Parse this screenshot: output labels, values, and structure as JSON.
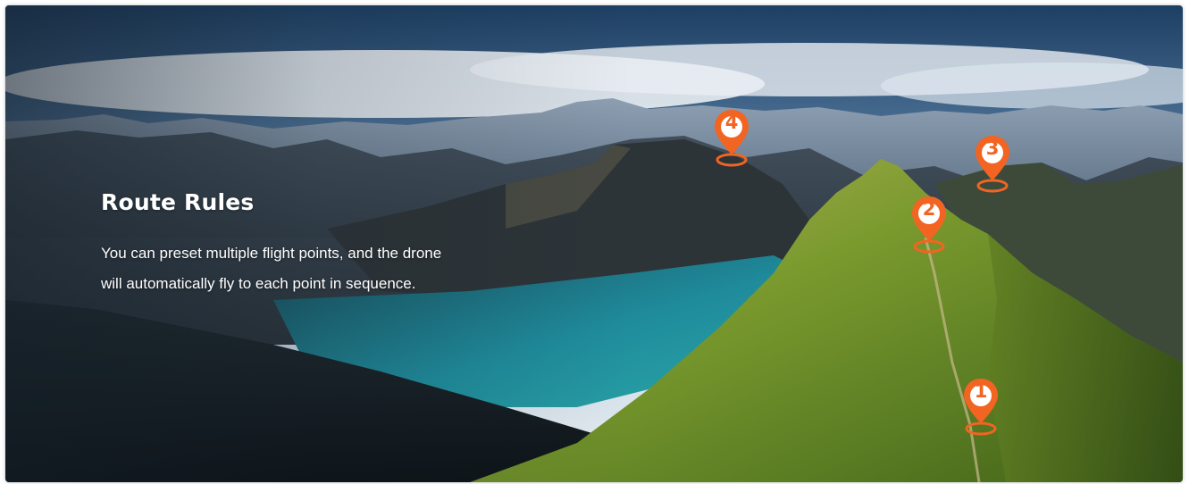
{
  "route": {
    "title": "Route Rules",
    "description_line1": "You can preset multiple flight points, and the drone",
    "description_line2": "will automatically fly to each point in sequence."
  },
  "waypoints": [
    {
      "label": "1"
    },
    {
      "label": "2"
    },
    {
      "label": "3"
    },
    {
      "label": "4"
    }
  ],
  "colors": {
    "pin": "#f26422",
    "lake": "#1f8c9c",
    "grass": "#7a9a2e"
  },
  "icons": {
    "waypoint": "map-pin-icon"
  }
}
